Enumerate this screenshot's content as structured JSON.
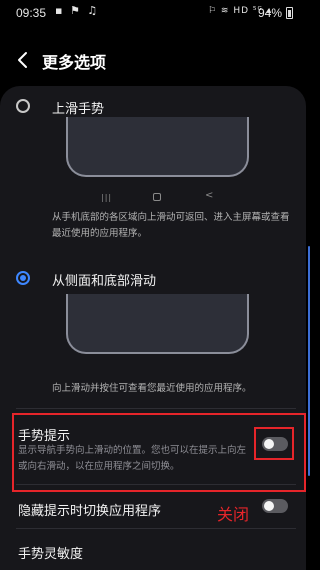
{
  "status_bar": {
    "time": "09:35",
    "left_icons": "▪ ⚑ ♫",
    "right_icons": "⚐ ≋ HD ⁵ᴳ ▴",
    "battery": "94%"
  },
  "header": {
    "title": "更多选项"
  },
  "options": [
    {
      "label": "上滑手势",
      "selected": false,
      "description": "从手机底部的各区域向上滑动可返回、进入主屏幕或查看最近使用的应用程序。",
      "nav_icons": {
        "recent": "|||",
        "home": "○",
        "back": "<"
      }
    },
    {
      "label": "从侧面和底部滑动",
      "selected": true,
      "description": "向上滑动并按住可查看您最近使用的应用程序。"
    }
  ],
  "gesture_hint": {
    "title": "手势提示",
    "description": "显示导航手势向上滑动的位置。您也可以在提示上向左或向右滑动，以在应用程序之间切换。",
    "toggle_on": false
  },
  "hide_hint_switch": {
    "label": "隐藏提示时切换应用程序",
    "toggle_on": false
  },
  "annotation": "关闭",
  "sensitivity": {
    "label": "手势灵敏度"
  },
  "colors": {
    "accent": "#3e87ff",
    "annotation_red": "#e6252a",
    "card_bg": "#17171b"
  }
}
